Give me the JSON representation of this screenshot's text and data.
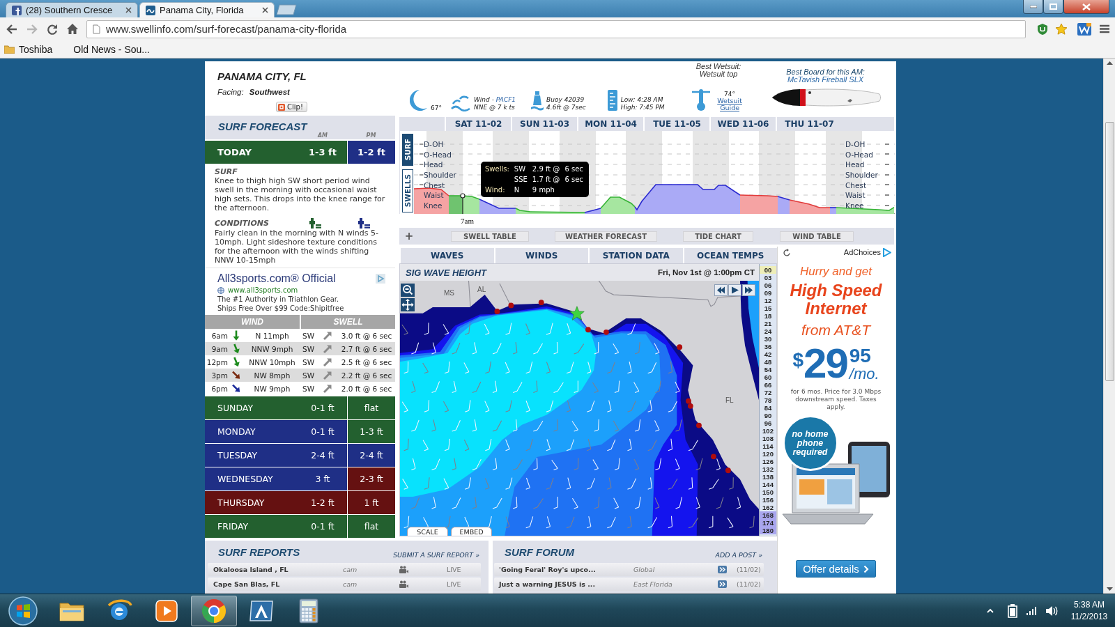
{
  "browser": {
    "tabs": [
      {
        "title": "(28) Southern Cresce",
        "kind": "social",
        "selected": false
      },
      {
        "title": "Panama City, Florida",
        "kind": "site",
        "selected": true
      }
    ],
    "url": "www.swellinfo.com/surf-forecast/panama-city-florida",
    "bookmarks": [
      {
        "label": "Toshiba",
        "kind": "folder"
      },
      {
        "label": "Old News - Sou...",
        "kind": "page"
      }
    ]
  },
  "header": {
    "city": "PANAMA CITY, FL",
    "facing_label": "Facing:",
    "facing": "Southwest",
    "clip": "Clip!",
    "moon_temp": "67°",
    "wind_label": "Wind -",
    "wind_station": "PACF1",
    "wind_reading": "NNE @ 7 k ts",
    "buoy": "Buoy 42039",
    "buoy_reading": "4.6ft @ 7sec",
    "tide_low": "Low: 4:28 AM",
    "tide_high": "High: 7:45 PM",
    "wetsuit_title": "Best Wetsuit:",
    "wetsuit": "Wetsuit top",
    "water_temp": "74°",
    "wetsuit_guide": "Wetsuit Guide",
    "board_title": "Best Board for this AM:",
    "board": "McTavish Fireball SLX"
  },
  "forecast": {
    "title": "SURF FORECAST",
    "am_label": "AM",
    "pm_label": "PM",
    "today": {
      "name": "TODAY",
      "am": {
        "height": "1-3 ft",
        "color": "#23602f"
      },
      "pm": {
        "height": "1-2 ft",
        "color": "#1f2f86"
      }
    },
    "surf_title": "SURF",
    "surf": "Knee to thigh high SW short period wind swell in the morning with occasional waist high sets. This drops into the knee range for the afternoon.",
    "conditions_title": "CONDITIONS",
    "conditions": "Fairly clean in the morning with N winds 5-10mph. Light sideshore texture conditions for the afternoon with the winds shifting NNW 10-15mph",
    "days": [
      {
        "name": "SUNDAY",
        "am": {
          "height": "0-1 ft",
          "color": "#23602f"
        },
        "pm": {
          "height": "flat",
          "color": "#23602f"
        }
      },
      {
        "name": "MONDAY",
        "am": {
          "height": "0-1 ft",
          "color": "#1f2f86"
        },
        "pm": {
          "height": "1-3 ft",
          "color": "#23602f"
        }
      },
      {
        "name": "TUESDAY",
        "am": {
          "height": "2-4 ft",
          "color": "#1f2f86"
        },
        "pm": {
          "height": "2-4 ft",
          "color": "#1f2f86"
        }
      },
      {
        "name": "WEDNESDAY",
        "am": {
          "height": "3 ft",
          "color": "#1f2f86"
        },
        "pm": {
          "height": "2-3 ft",
          "color": "#651111"
        }
      },
      {
        "name": "THURSDAY",
        "am": {
          "height": "1-2 ft",
          "color": "#651111"
        },
        "pm": {
          "height": "1 ft",
          "color": "#651111"
        }
      },
      {
        "name": "FRIDAY",
        "am": {
          "height": "0-1 ft",
          "color": "#23602f"
        },
        "pm": {
          "height": "flat",
          "color": "#23602f"
        }
      }
    ]
  },
  "text_ad": {
    "title": "All3sports.com® Official",
    "url": "www.all3sports.com",
    "lines": [
      "The #1 Authority in Triathlon Gear.",
      "Ships Free Over $99 Code:Shipitfree"
    ]
  },
  "hourly": {
    "wind_title": "WIND",
    "swell_title": "SWELL",
    "rows": [
      {
        "time": "6am",
        "kind": "n",
        "color": "#1c8a1c",
        "wind": "N 11mph",
        "swell_dir": "SW",
        "swell": "3.0 ft @ 6 sec"
      },
      {
        "time": "9am",
        "kind": "nnw",
        "color": "#1c8a1c",
        "wind": "NNW 9mph",
        "swell_dir": "SW",
        "swell": "2.7 ft @ 6 sec"
      },
      {
        "time": "12pm",
        "kind": "nnw",
        "color": "#1c8a1c",
        "wind": "NNW 10mph",
        "swell_dir": "SW",
        "swell": "2.5 ft @ 6 sec"
      },
      {
        "time": "3pm",
        "kind": "nw",
        "color": "#7a2a10",
        "wind": "NW 8mph",
        "swell_dir": "SW",
        "swell": "2.2 ft @ 6 sec"
      },
      {
        "time": "6pm",
        "kind": "nw",
        "color": "#1a2a9a",
        "wind": "NW 9mph",
        "swell_dir": "SW",
        "swell": "2.0 ft @ 6 sec"
      }
    ]
  },
  "outlook": {
    "days": [
      "SAT 11-02",
      "SUN 11-03",
      "MON 11-04",
      "TUE 11-05",
      "WED 11-06",
      "THU 11-07"
    ],
    "views": [
      {
        "label": "SURF",
        "selected": true
      },
      {
        "label": "SWELLS",
        "selected": false
      }
    ],
    "left_labels": [
      "D-OH",
      "O-Head",
      "Head",
      "Shoulder",
      "Chest",
      "Waist",
      "Knee"
    ],
    "right_labels": [
      "D-OH",
      "O-Head",
      "Head",
      "Shoulder",
      "Chest",
      "Waist",
      "Knee"
    ],
    "tooltip": [
      {
        "label": "Swells:",
        "dir": "SW",
        "height": "2.9 ft @",
        "period": "6 sec"
      },
      {
        "dir": "SSE",
        "height": "1.7 ft @",
        "period": "6 sec"
      },
      {
        "label": "Wind:",
        "dir": "N",
        "speed": "9 mph"
      }
    ],
    "time": "7am",
    "add": "+",
    "tables": [
      "SWELL TABLE",
      "WEATHER FORECAST",
      "TIDE CHART",
      "WIND TABLE"
    ]
  },
  "map": {
    "tabs": [
      "WAVES",
      "WINDS",
      "STATION DATA",
      "OCEAN TEMPS"
    ],
    "title": "SIG WAVE HEIGHT",
    "time": "Fri, Nov 1st @ 1:00pm CT",
    "labels": [
      "MS",
      "AL",
      "FL"
    ],
    "scale": [
      {
        "label": "00",
        "selected": true,
        "shaded": false
      },
      {
        "label": "03",
        "selected": false,
        "shaded": false
      },
      {
        "label": "06",
        "selected": false,
        "shaded": false
      },
      {
        "label": "09",
        "selected": false,
        "shaded": false
      },
      {
        "label": "12",
        "selected": false,
        "shaded": false
      },
      {
        "label": "15",
        "selected": false,
        "shaded": false
      },
      {
        "label": "18",
        "selected": false,
        "shaded": false
      },
      {
        "label": "21",
        "selected": false,
        "shaded": false
      },
      {
        "label": "24",
        "selected": false,
        "shaded": false
      },
      {
        "label": "30",
        "selected": false,
        "shaded": false
      },
      {
        "label": "36",
        "selected": false,
        "shaded": false
      },
      {
        "label": "42",
        "selected": false,
        "shaded": false
      },
      {
        "label": "48",
        "selected": false,
        "shaded": false
      },
      {
        "label": "54",
        "selected": false,
        "shaded": false
      },
      {
        "label": "60",
        "selected": false,
        "shaded": false
      },
      {
        "label": "66",
        "selected": false,
        "shaded": false
      },
      {
        "label": "72",
        "selected": false,
        "shaded": false
      },
      {
        "label": "78",
        "selected": false,
        "shaded": false
      },
      {
        "label": "84",
        "selected": false,
        "shaded": false
      },
      {
        "label": "90",
        "selected": false,
        "shaded": false
      },
      {
        "label": "96",
        "selected": false,
        "shaded": false
      },
      {
        "label": "102",
        "selected": false,
        "shaded": false
      },
      {
        "label": "108",
        "selected": false,
        "shaded": false
      },
      {
        "label": "114",
        "selected": false,
        "shaded": false
      },
      {
        "label": "120",
        "selected": false,
        "shaded": false
      },
      {
        "label": "126",
        "selected": false,
        "shaded": false
      },
      {
        "label": "132",
        "selected": false,
        "shaded": false
      },
      {
        "label": "138",
        "selected": false,
        "shaded": false
      },
      {
        "label": "144",
        "selected": false,
        "shaded": false
      },
      {
        "label": "150",
        "selected": false,
        "shaded": false
      },
      {
        "label": "156",
        "selected": false,
        "shaded": false
      },
      {
        "label": "162",
        "selected": false,
        "shaded": false
      },
      {
        "label": "168",
        "selected": false,
        "shaded": true
      },
      {
        "label": "174",
        "selected": false,
        "shaded": true
      },
      {
        "label": "180",
        "selected": false,
        "shaded": true
      }
    ],
    "buttons": [
      "SCALE",
      "EMBED"
    ]
  },
  "display_ad": {
    "adchoices": "AdChoices",
    "line1": "Hurry and get",
    "line2": "High Speed Internet",
    "line3": "from AT&T",
    "currency": "$",
    "dollars": "29",
    "cents": "95",
    "unit": "/mo.",
    "fine_print": "for 6 mos. Price for 3.0 Mbps downstream speed. Taxes apply.",
    "badge": "no home phone required",
    "button": "Offer details"
  },
  "reports": {
    "title": "SURF REPORTS",
    "action": "SUBMIT A SURF REPORT »",
    "rows": [
      {
        "spot": "Okaloosa Island , FL",
        "type": "cam",
        "status": "LIVE"
      },
      {
        "spot": "Cape San Blas, FL",
        "type": "cam",
        "status": "LIVE"
      }
    ]
  },
  "forum": {
    "title": "SURF FORUM",
    "action": "ADD A POST »",
    "rows": [
      {
        "topic": "'Going Feral' Roy's upco...",
        "region": "Global",
        "date": "(11/02)"
      },
      {
        "topic": "Just a warning JESUS is ...",
        "region": "East Florida",
        "date": "(11/02)"
      }
    ]
  },
  "taskbar": {
    "apps": [
      {
        "kind": "explorer",
        "selected": false
      },
      {
        "kind": "web",
        "selected": false
      },
      {
        "kind": "media",
        "selected": false
      },
      {
        "kind": "chrome",
        "selected": true
      },
      {
        "kind": "tile",
        "selected": false
      },
      {
        "kind": "calculator",
        "selected": false
      }
    ],
    "time": "5:38 AM",
    "date": "11/2/2013"
  }
}
